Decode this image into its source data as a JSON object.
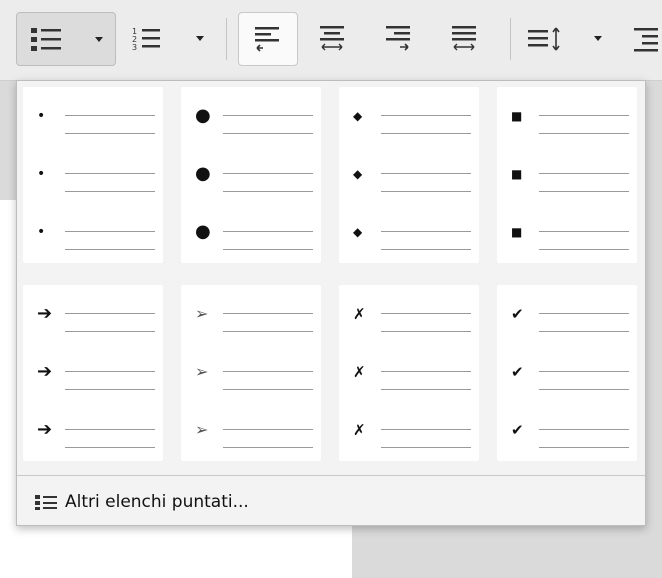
{
  "toolbar": {
    "buttons": [
      {
        "name": "unordered-list-icon"
      },
      {
        "name": "ordered-list-icon"
      },
      {
        "name": "align-left-icon"
      },
      {
        "name": "align-center-icon"
      },
      {
        "name": "align-right-icon"
      },
      {
        "name": "align-justify-icon"
      },
      {
        "name": "line-spacing-icon"
      },
      {
        "name": "indent-icon"
      }
    ],
    "ordered_list_digits": [
      "1",
      "2",
      "3"
    ]
  },
  "bullet_styles": {
    "row1": [
      {
        "name": "small-dot",
        "symbol": "•"
      },
      {
        "name": "large-dot",
        "symbol": "●"
      },
      {
        "name": "diamond",
        "symbol": "◆"
      },
      {
        "name": "square",
        "symbol": "■"
      }
    ],
    "row2": [
      {
        "name": "bold-arrow",
        "symbol": "➔"
      },
      {
        "name": "arrowhead",
        "symbol": "➢"
      },
      {
        "name": "x-mark",
        "symbol": "✗"
      },
      {
        "name": "check-mark",
        "symbol": "✔"
      }
    ]
  },
  "footer": {
    "more_label": "Altri elenchi puntati...",
    "icon": "bullet-list-icon"
  },
  "colors": {
    "toolbar_bg": "#ececec",
    "popup_bg": "#f3f3f3",
    "tile_bg": "#ffffff",
    "arrowhead_fill": "#e8c8a0"
  }
}
